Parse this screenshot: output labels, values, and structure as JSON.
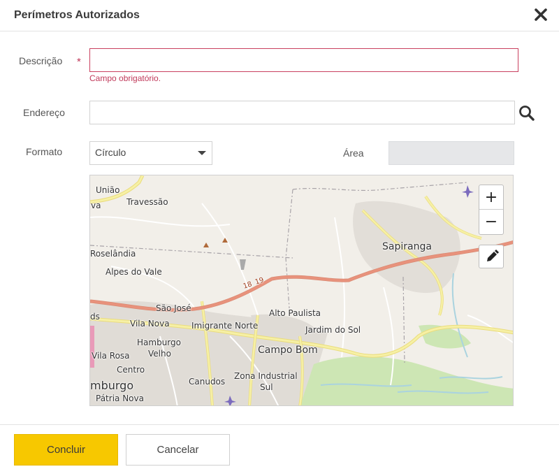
{
  "dialog": {
    "title": "Perímetros Autorizados",
    "close_icon": "close-icon"
  },
  "form": {
    "descricao": {
      "label": "Descrição",
      "required_mark": "*",
      "value": "",
      "error": "Campo obrigatório."
    },
    "endereco": {
      "label": "Endereço",
      "value": "",
      "search_icon": "search-icon"
    },
    "formato": {
      "label": "Formato",
      "selected": "Círculo"
    },
    "area": {
      "label": "Área",
      "value": ""
    }
  },
  "map": {
    "zoom_in": "+",
    "zoom_out": "−",
    "draw_icon": "pencil-icon",
    "labels": {
      "uniao": "União",
      "va": "va",
      "travessao": "Travessão",
      "roselandia": "Roselândia",
      "alpes_do_vale": "Alpes do Vale",
      "sapiranga": "Sapiranga",
      "road_number": "18",
      "road_number2": "19",
      "sao_jose": "São José",
      "alto_paulista": "Alto Paulista",
      "ds": "ds",
      "vila_nova": "Vila Nova",
      "imigrante_norte": "Imigrante Norte",
      "jardim_do_sol": "Jardim do Sol",
      "hamburgo_velho_1": "Hamburgo",
      "hamburgo_velho_2": "Velho",
      "campo_bom": "Campo Bom",
      "vila_rosa": "Vila Rosa",
      "centro": "Centro",
      "mburgo": "mburgo",
      "canudos": "Canudos",
      "zona_industrial_1": "Zona Industrial",
      "zona_industrial_2": "Sul",
      "patria_nova": "Pátria Nova"
    }
  },
  "footer": {
    "confirm_label": "Concluir",
    "cancel_label": "Cancelar"
  },
  "colors": {
    "primary": "#f7c800",
    "error": "#c0395a",
    "map_bg": "#f2efe9",
    "highway": "#e8927c",
    "road_major": "#f6f0a5",
    "water": "#aad3df",
    "park": "#cde6b4"
  }
}
